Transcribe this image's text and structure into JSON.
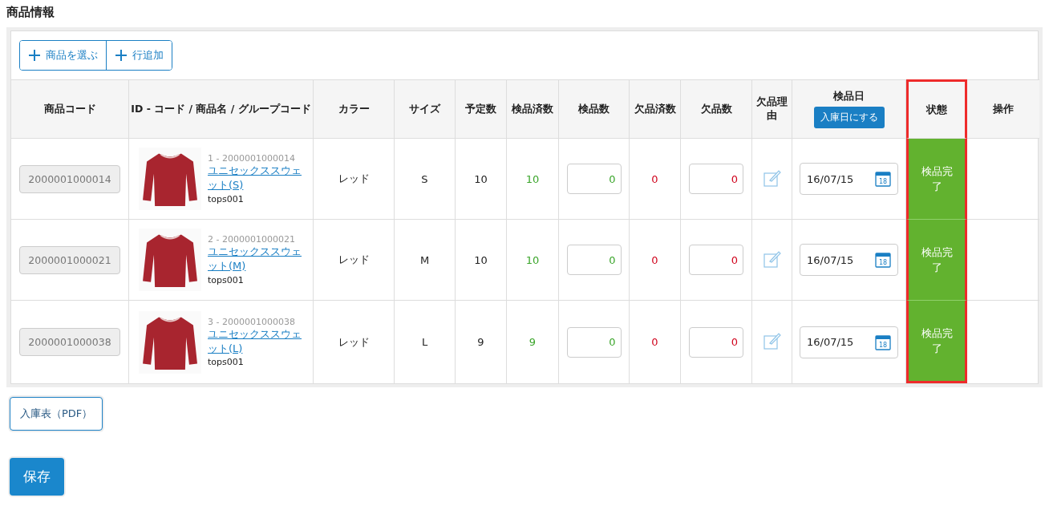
{
  "section_title": "商品情報",
  "toolbar": [
    {
      "label": "商品を選ぶ"
    },
    {
      "label": "行追加"
    }
  ],
  "columns": [
    {
      "label": "商品コード",
      "highlighted": false
    },
    {
      "label": "ID - コード / 商品名 / グループコード",
      "highlighted": false
    },
    {
      "label": "カラー",
      "highlighted": false
    },
    {
      "label": "サイズ",
      "highlighted": false
    },
    {
      "label": "予定数",
      "highlighted": false
    },
    {
      "label": "検品済数",
      "highlighted": false
    },
    {
      "label": "検品数",
      "highlighted": false
    },
    {
      "label": "欠品済数",
      "highlighted": false
    },
    {
      "label": "欠品数",
      "highlighted": false
    },
    {
      "label": "欠品理由",
      "highlighted": false
    },
    {
      "label": "検品日",
      "button": "入庫日にする",
      "highlighted": false
    },
    {
      "label": "状態",
      "highlighted": true
    },
    {
      "label": "操作",
      "highlighted": false
    }
  ],
  "rows": [
    {
      "code": "2000001000014",
      "id_code": "1 - 2000001000014",
      "name": "ユニセックススウェット(S)",
      "group": "tops001",
      "color_name": "レッド",
      "size": "S",
      "planned": "10",
      "inspected_done": "10",
      "inspect_input": "0",
      "missing_done": "0",
      "missing_input": "0",
      "date": "16/07/15",
      "calendar_day": "18",
      "status": "検品完了"
    },
    {
      "code": "2000001000021",
      "id_code": "2 - 2000001000021",
      "name": "ユニセックススウェット(M)",
      "group": "tops001",
      "color_name": "レッド",
      "size": "M",
      "planned": "10",
      "inspected_done": "10",
      "inspect_input": "0",
      "missing_done": "0",
      "missing_input": "0",
      "date": "16/07/15",
      "calendar_day": "18",
      "status": "検品完了"
    },
    {
      "code": "2000001000038",
      "id_code": "3 - 2000001000038",
      "name": "ユニセックススウェット(L)",
      "group": "tops001",
      "color_name": "レッド",
      "size": "L",
      "planned": "9",
      "inspected_done": "9",
      "inspect_input": "0",
      "missing_done": "0",
      "missing_input": "0",
      "date": "16/07/15",
      "calendar_day": "18",
      "status": "検品完了"
    }
  ],
  "buttons": [
    {
      "label": "入庫表（PDF）",
      "kind": "secondary"
    },
    {
      "label": "保存",
      "kind": "primary"
    }
  ]
}
